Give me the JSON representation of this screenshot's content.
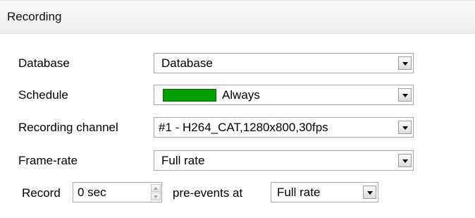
{
  "panel": {
    "title": "Recording"
  },
  "database": {
    "label": "Database",
    "value": "Database",
    "arrow_icon": "chevron-down-icon"
  },
  "schedule": {
    "label": "Schedule",
    "value": "Always",
    "swatch_color": "#00A000"
  },
  "recording_channel": {
    "label": "Recording channel",
    "value": "#1 - H264_CAT,1280x800,30fps"
  },
  "frame_rate": {
    "label": "Frame-rate",
    "value": "Full rate"
  },
  "pre_events": {
    "record_label": "Record",
    "duration_value": "0 sec",
    "middle_label": "pre-events at",
    "rate_value": "Full rate"
  }
}
